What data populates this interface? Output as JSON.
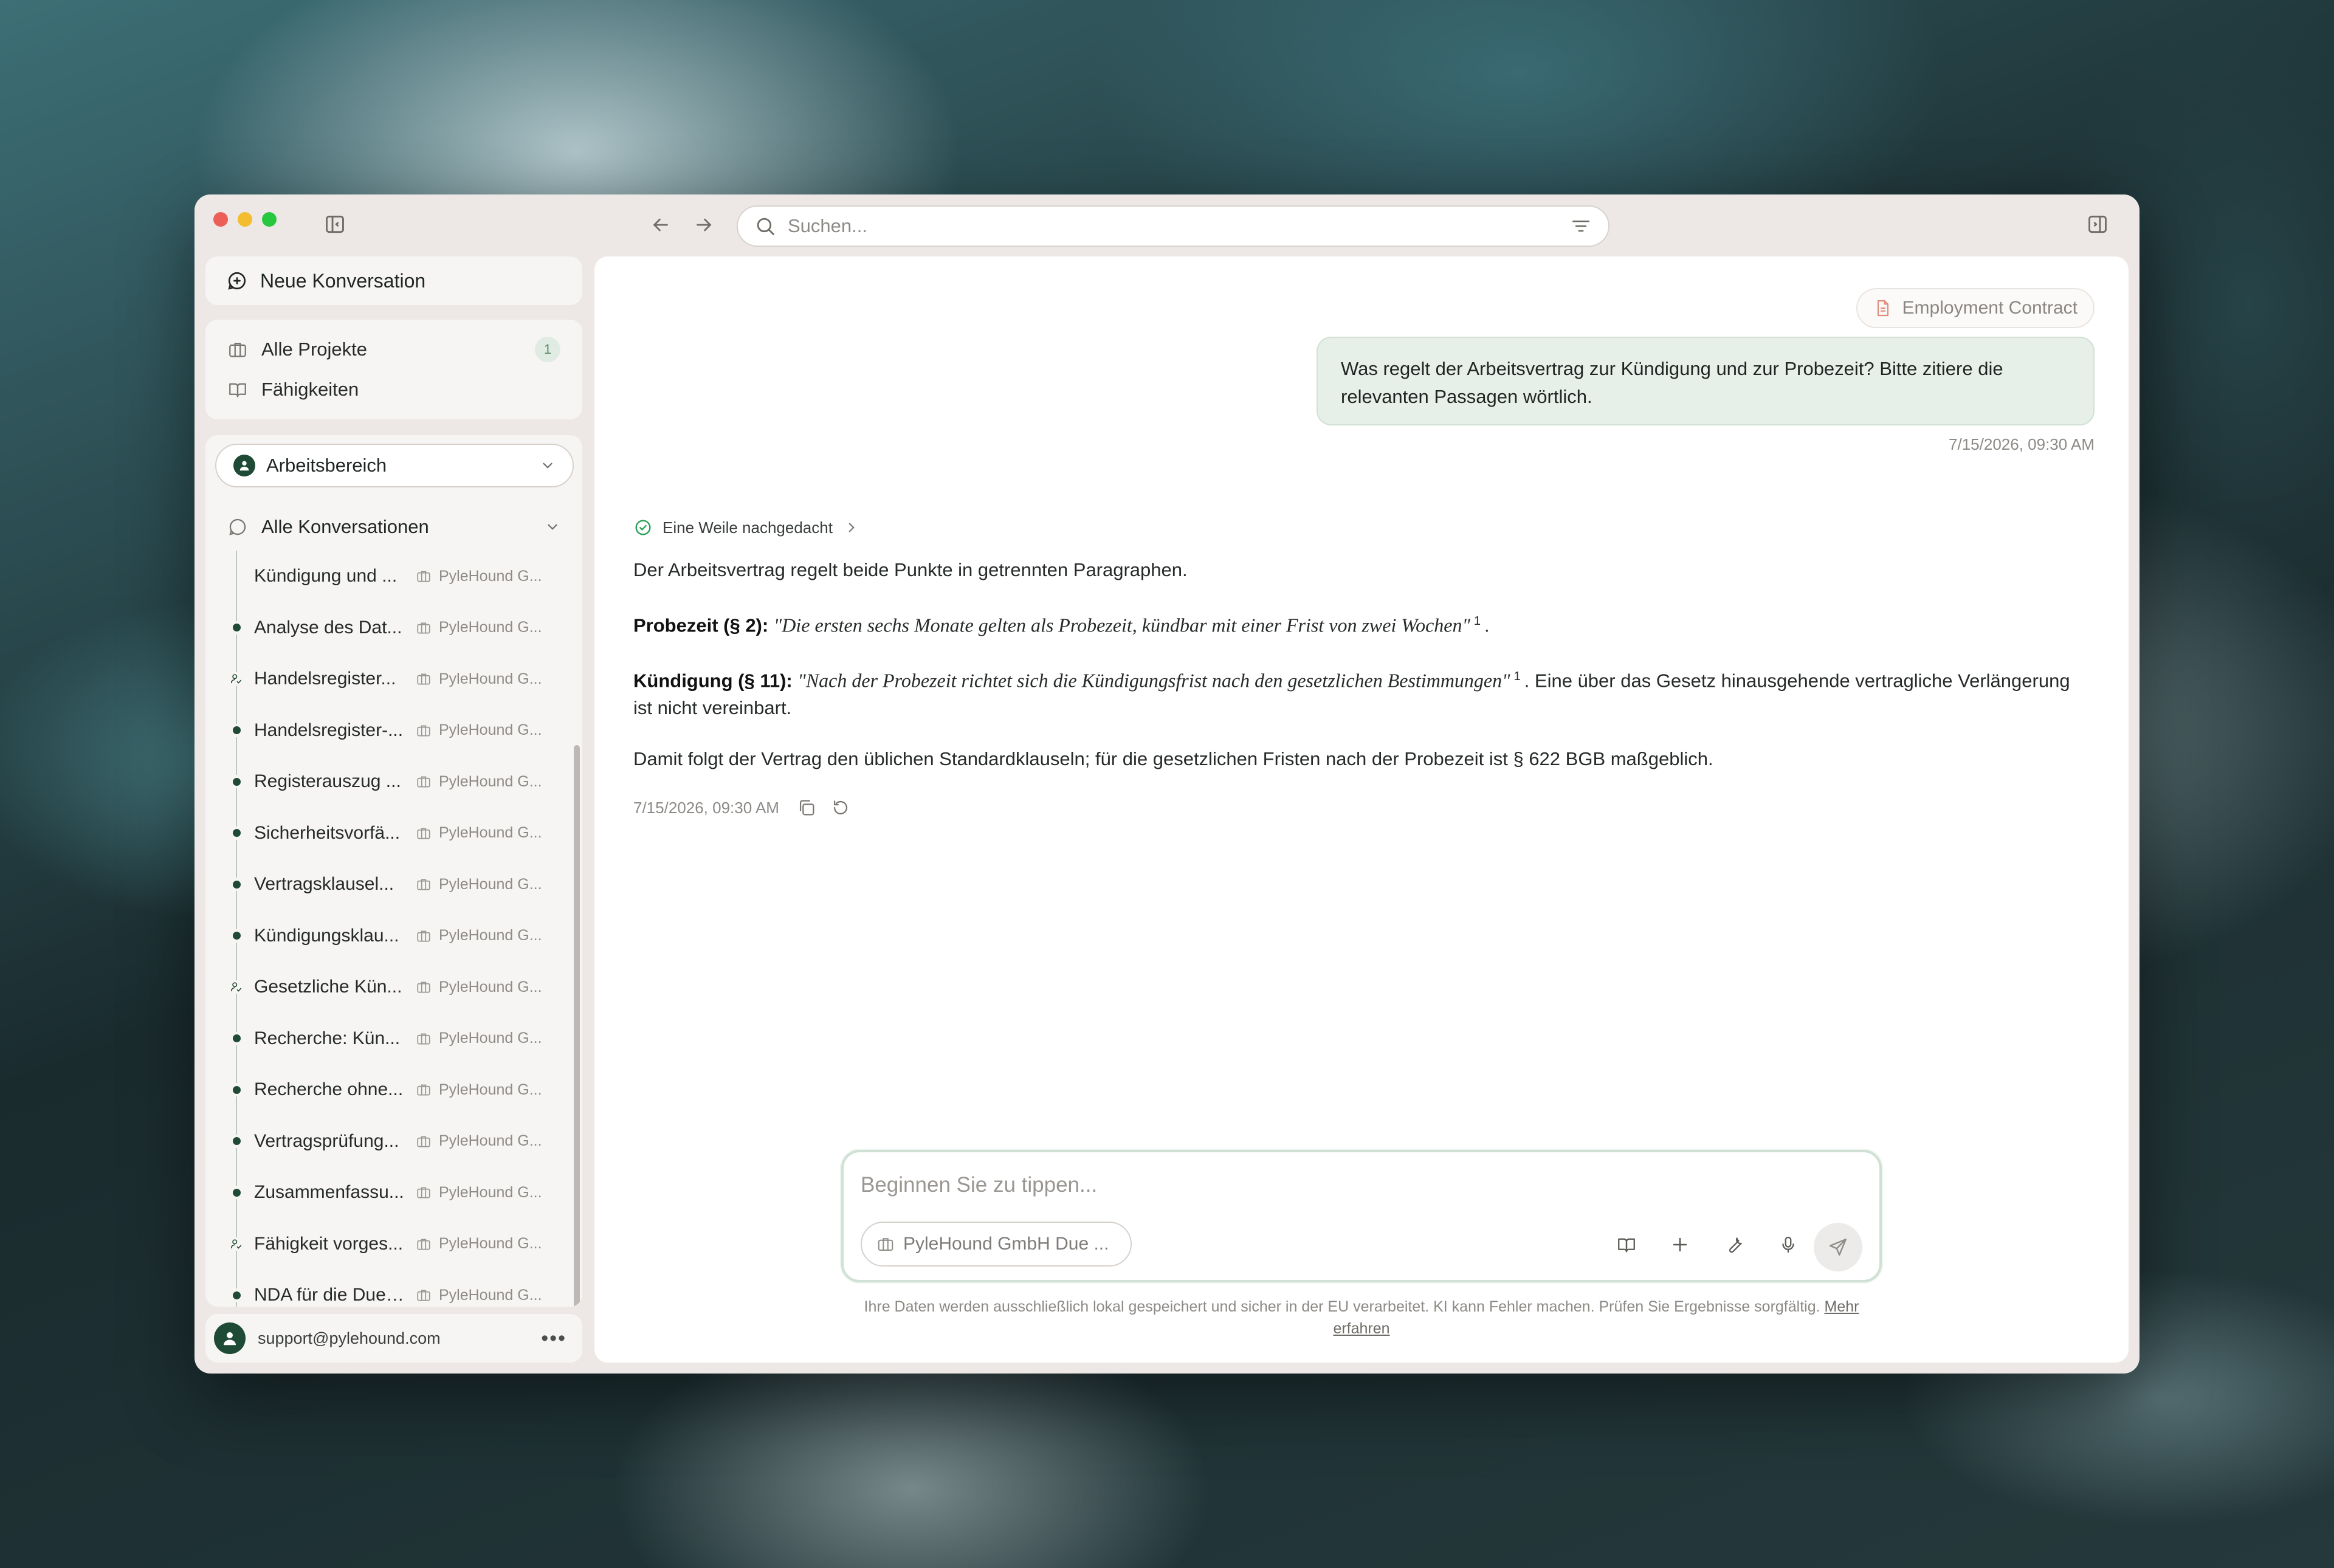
{
  "search": {
    "placeholder": "Suchen..."
  },
  "sidebar": {
    "new_conversation": "Neue Konversation",
    "nav": [
      {
        "label": "Alle Projekte",
        "badge": "1"
      },
      {
        "label": "Fähigkeiten"
      }
    ],
    "workspace": "Arbeitsbereich",
    "all_conversations": "Alle Konversationen",
    "conversations": [
      {
        "title": "Kündigung und ...",
        "project": "PyleHound G...",
        "marker": "none"
      },
      {
        "title": "Analyse des Dat...",
        "project": "PyleHound G...",
        "marker": "dot"
      },
      {
        "title": "Handelsregister...",
        "project": "PyleHound G...",
        "marker": "user-check"
      },
      {
        "title": "Handelsregister-...",
        "project": "PyleHound G...",
        "marker": "dot"
      },
      {
        "title": "Registerauszug ...",
        "project": "PyleHound G...",
        "marker": "dot"
      },
      {
        "title": "Sicherheitsvorfä...",
        "project": "PyleHound G...",
        "marker": "dot"
      },
      {
        "title": "Vertragsklausel...",
        "project": "PyleHound G...",
        "marker": "dot"
      },
      {
        "title": "Kündigungsklau...",
        "project": "PyleHound G...",
        "marker": "dot"
      },
      {
        "title": "Gesetzliche Kün...",
        "project": "PyleHound G...",
        "marker": "user-check"
      },
      {
        "title": "Recherche: Kün...",
        "project": "PyleHound G...",
        "marker": "dot"
      },
      {
        "title": "Recherche ohne...",
        "project": "PyleHound G...",
        "marker": "dot"
      },
      {
        "title": "Vertragsprüfung...",
        "project": "PyleHound G...",
        "marker": "dot"
      },
      {
        "title": "Zusammenfassu...",
        "project": "PyleHound G...",
        "marker": "dot"
      },
      {
        "title": "Fähigkeit vorges...",
        "project": "PyleHound G...",
        "marker": "user-check"
      },
      {
        "title": "NDA für die Due ...",
        "project": "PyleHound G...",
        "marker": "dot"
      }
    ],
    "user_email": "support@pylehound.com",
    "more": "•••"
  },
  "chat": {
    "attachment": "Employment Contract",
    "user_message": "Was regelt der Arbeitsvertrag zur Kündigung und zur Probezeit? Bitte zitiere die relevanten Passagen wörtlich.",
    "user_timestamp": "7/15/2026, 09:30 AM",
    "thinking_label": "Eine Weile nachgedacht",
    "answer_intro": "Der Arbeitsvertrag regelt beide Punkte in getrennten Paragraphen.",
    "probezeit_label": "Probezeit (§ 2):",
    "probezeit_quote": "\"Die ersten sechs Monate gelten als Probezeit, kündbar mit einer Frist von zwei Wochen\"",
    "probezeit_cite": "1",
    "probezeit_after": ".",
    "kuendigung_label": "Kündigung (§ 11):",
    "kuendigung_quote": "\"Nach der Probezeit richtet sich die Kündigungsfrist nach den gesetzlichen Bestimmungen\"",
    "kuendigung_cite": "1",
    "kuendigung_after": ". Eine über das Gesetz hinausgehende vertragliche Verlängerung ist nicht vereinbart.",
    "answer_conclusion": "Damit folgt der Vertrag den üblichen Standardklauseln; für die gesetzlichen Fristen nach der Probezeit ist § 622 BGB maßgeblich.",
    "answer_timestamp": "7/15/2026, 09:30 AM"
  },
  "composer": {
    "placeholder": "Beginnen Sie zu tippen...",
    "project_pill": "PyleHound GmbH Due ...",
    "disclaimer_text": "Ihre Daten werden ausschließlich lokal gespeichert und sicher in der EU verarbeitet. KI kann Fehler machen. Prüfen Sie Ergebnisse sorgfältig.",
    "disclaimer_link": "Mehr erfahren"
  },
  "colors": {
    "accent_dark_green": "#1f4a35",
    "bubble_green": "#e6efe8",
    "check_green": "#2aa15a",
    "window_bg": "#ede8e5"
  }
}
